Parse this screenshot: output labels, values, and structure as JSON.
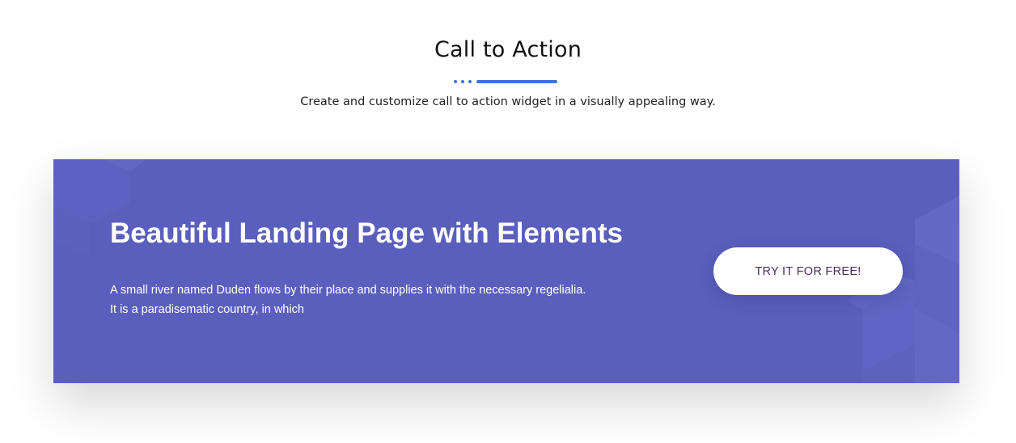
{
  "header": {
    "title": "Call to Action",
    "subtitle": "Create and customize call to action widget in a visually appealing way."
  },
  "cta": {
    "heading": "Beautiful Landing Page with Elements",
    "text_line_1": "A small river named Duden flows by their place and supplies it with the necessary regelialia.",
    "text_line_2": "It is a paradisematic country, in which",
    "button_label": "TRY IT FOR FREE!"
  },
  "colors": {
    "accent": "#3a75d8",
    "card_background": "#5a5fbd",
    "button_background": "#ffffff",
    "button_text": "#4a2a5c",
    "heading_text": "#ffffff"
  }
}
